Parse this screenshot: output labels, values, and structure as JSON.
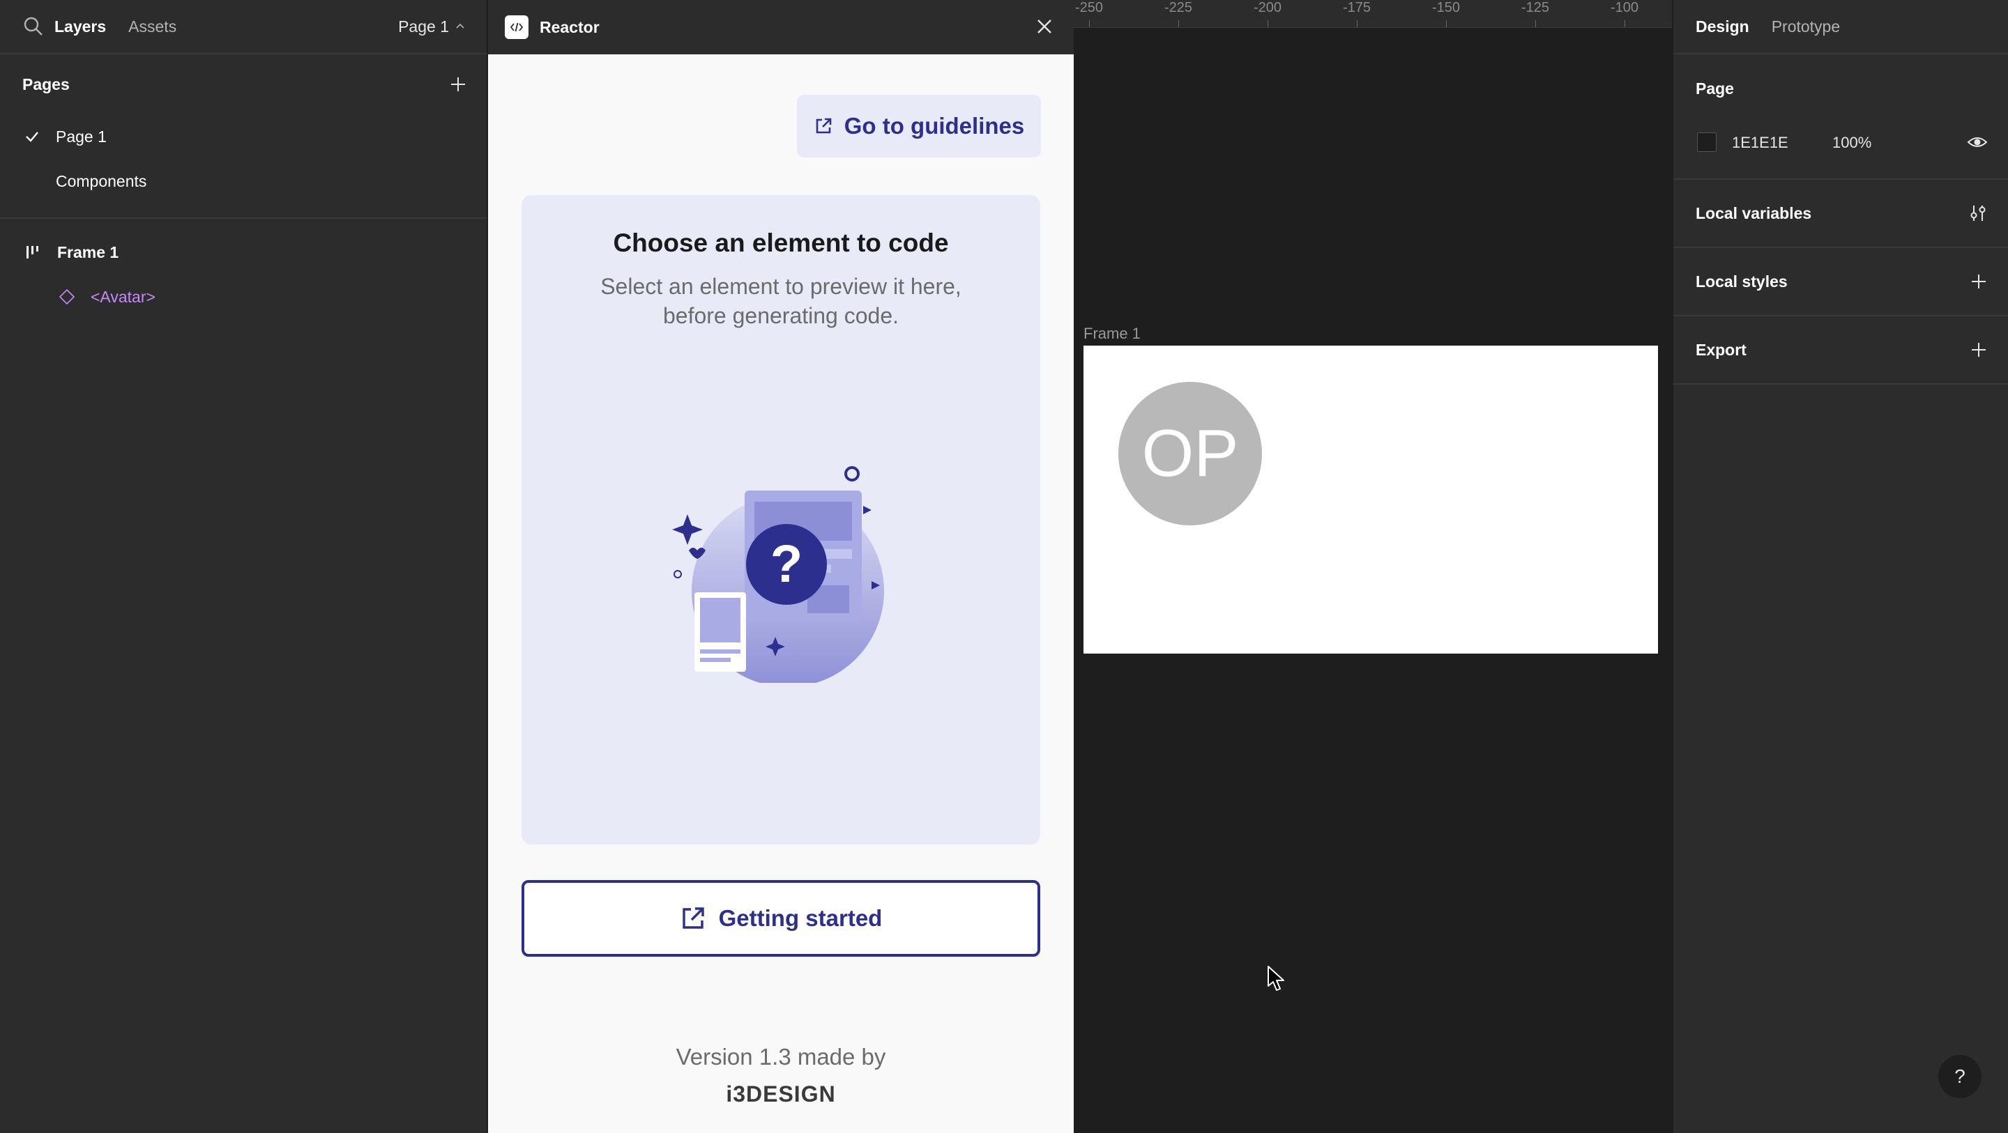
{
  "left_panel": {
    "tabs": [
      "Layers",
      "Assets"
    ],
    "page_switcher": "Page 1",
    "pages_title": "Pages",
    "pages": [
      "Page 1",
      "Components"
    ],
    "layers": {
      "frame": "Frame 1",
      "component": "<Avatar>"
    }
  },
  "plugin": {
    "title": "Reactor",
    "guidelines_label": "Go to guidelines",
    "card_heading": "Choose an element to code",
    "card_sub": "Select an element to preview it here, before generating code.",
    "getting_started_label": "Getting started",
    "version_text": "Version 1.3 made by",
    "brand": "i3DESIGN"
  },
  "canvas": {
    "ruler_ticks": [
      "-250",
      "-225",
      "-200",
      "-175",
      "-150",
      "-125",
      "-100"
    ],
    "frame_label": "Frame 1",
    "avatar_initials": "OP"
  },
  "right_panel": {
    "tabs": [
      "Design",
      "Prototype"
    ],
    "page_title": "Page",
    "page_color": "1E1E1E",
    "page_opacity": "100%",
    "local_variables": "Local variables",
    "local_styles": "Local styles",
    "export": "Export",
    "help": "?"
  },
  "colors": {
    "brand_indigo": "#2d2f8f",
    "component_purple": "#c58af9",
    "panel_bg": "#2c2c2c",
    "canvas_bg": "#1e1e1e"
  }
}
